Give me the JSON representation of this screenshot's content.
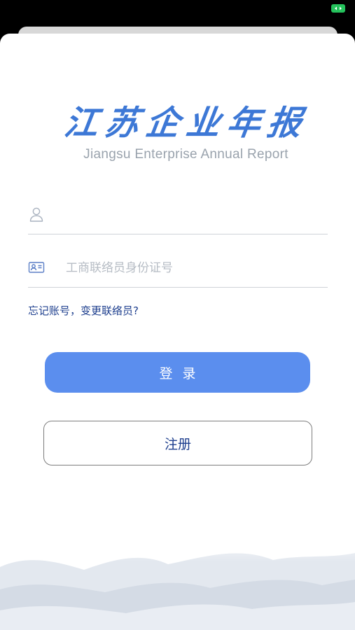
{
  "app": {
    "title_cn": "江苏企业年报",
    "title_en": "Jiangsu Enterprise Annual Report"
  },
  "account_field": {
    "value": "",
    "placeholder": "",
    "icon": "user-icon"
  },
  "id_field": {
    "value": "",
    "placeholder": "工商联络员身份证号",
    "icon": "id-card-icon"
  },
  "forgot_link": "忘记账号，变更联络员?",
  "login_button": "登录",
  "register_button": "注册",
  "colors": {
    "primary": "#5b8eee",
    "logo": "#3d78d6",
    "link": "#1e3f8e",
    "status_indicator": "#25c25c"
  }
}
